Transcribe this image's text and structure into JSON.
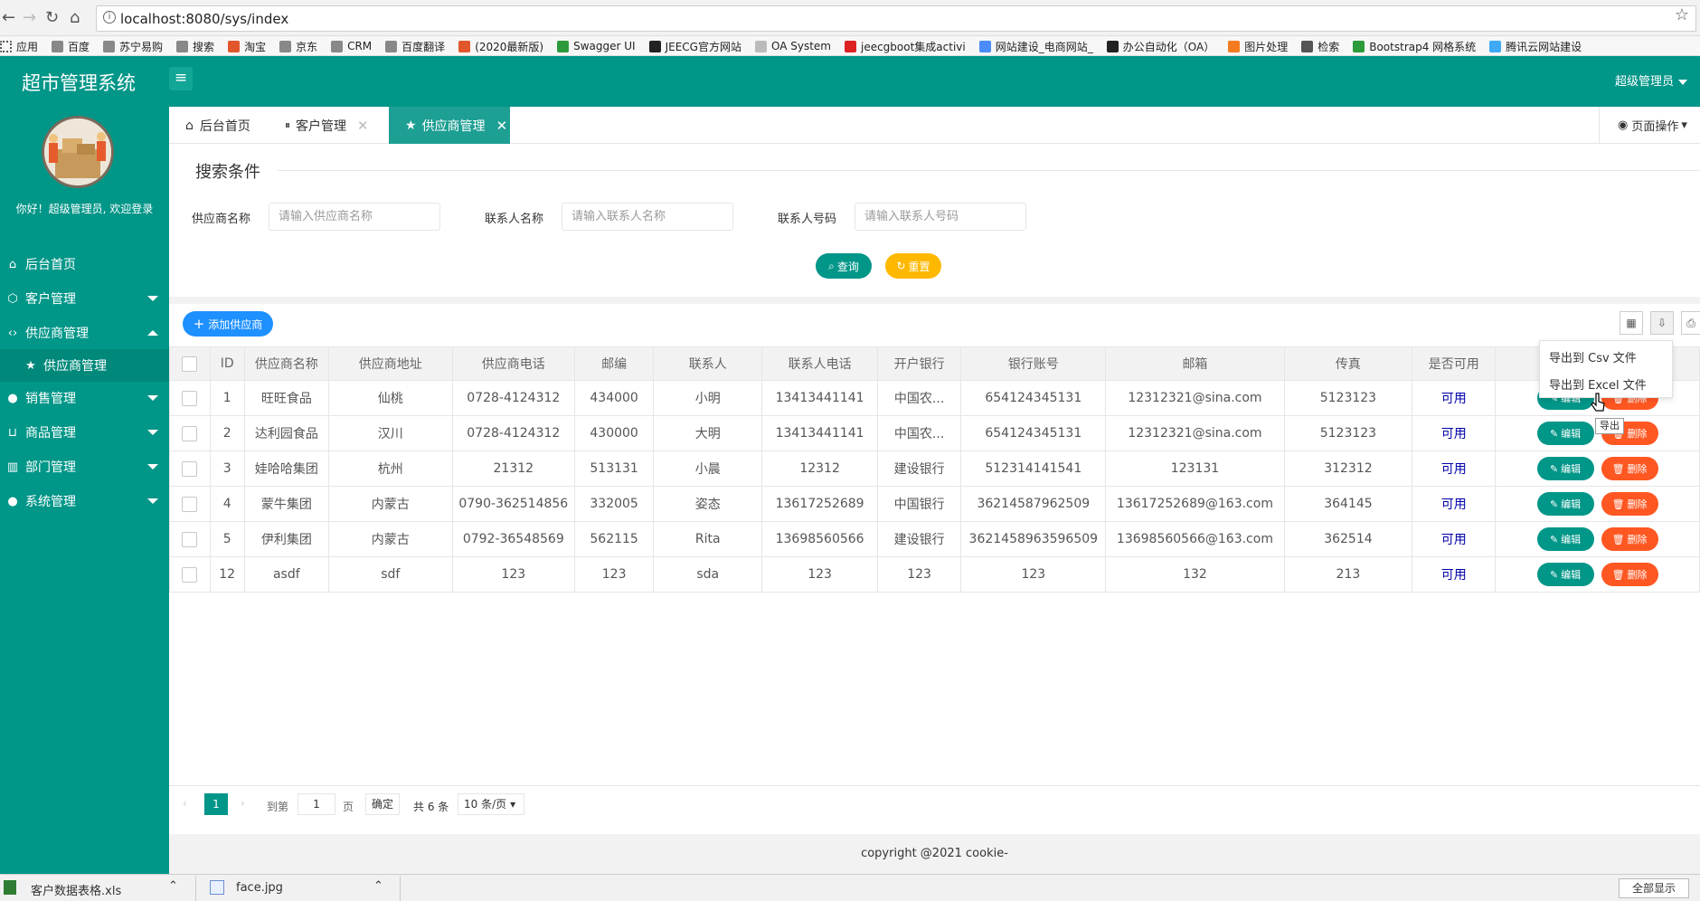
{
  "browser": {
    "url": "localhost:8080/sys/index",
    "bookmarks": [
      "应用",
      "百度",
      "苏宁易购",
      "搜索",
      "淘宝",
      "京东",
      "CRM",
      "百度翻译",
      "(2020最新版)",
      "Swagger UI",
      "JEECG官方网站",
      "OA System",
      "jeecgboot集成activi",
      "网站建设_电商网站_",
      "办公自动化（OA）",
      "图片处理",
      "检索",
      "Bootstrap4 网格系统",
      "腾讯云网站建设"
    ]
  },
  "app": {
    "title": "超市管理系统",
    "user": "超级管理员",
    "welcome": "你好！超级管理员, 欢迎登录"
  },
  "sidebar": {
    "items": [
      {
        "label": "后台首页",
        "icon": "home-icon"
      },
      {
        "label": "客户管理",
        "icon": "cube-icon"
      },
      {
        "label": "供应商管理",
        "icon": "code-icon"
      },
      {
        "label": "供应商管理",
        "icon": "star-icon"
      },
      {
        "label": "销售管理",
        "icon": "chat-icon"
      },
      {
        "label": "商品管理",
        "icon": "cart-icon"
      },
      {
        "label": "部门管理",
        "icon": "building-icon"
      },
      {
        "label": "系统管理",
        "icon": "user-icon"
      }
    ]
  },
  "tabs": {
    "items": [
      "后台首页",
      "客户管理",
      "供应商管理"
    ],
    "page_ops": "页面操作"
  },
  "search": {
    "legend": "搜索条件",
    "name_label": "供应商名称",
    "name_placeholder": "请输入供应商名称",
    "contact_label": "联系人名称",
    "contact_placeholder": "请输入联系人名称",
    "phone_label": "联系人号码",
    "phone_placeholder": "请输入联系人号码",
    "query": "查询",
    "reset": "重置"
  },
  "toolbar": {
    "add": "添加供应商",
    "export_menu": [
      "导出到 Csv 文件",
      "导出到 Excel 文件"
    ],
    "tooltip": "导出"
  },
  "table": {
    "headers": [
      "ID",
      "供应商名称",
      "供应商地址",
      "供应商电话",
      "邮编",
      "联系人",
      "联系人电话",
      "开户银行",
      "银行账号",
      "邮箱",
      "传真",
      "是否可用"
    ],
    "edit": "编辑",
    "delete": "删除",
    "rows": [
      [
        "1",
        "旺旺食品",
        "仙桃",
        "0728-4124312",
        "434000",
        "小明",
        "13413441141",
        "中国农...",
        "654124345131",
        "12312321@sina.com",
        "5123123",
        "可用"
      ],
      [
        "2",
        "达利园食品",
        "汉川",
        "0728-4124312",
        "430000",
        "大明",
        "13413441141",
        "中国农...",
        "654124345131",
        "12312321@sina.com",
        "5123123",
        "可用"
      ],
      [
        "3",
        "娃哈哈集团",
        "杭州",
        "21312",
        "513131",
        "小晨",
        "12312",
        "建设银行",
        "512314141541",
        "123131",
        "312312",
        "可用"
      ],
      [
        "4",
        "蒙牛集团",
        "内蒙古",
        "0790-362514856",
        "332005",
        "姿态",
        "13617252689",
        "中国银行",
        "36214587962509",
        "13617252689@163.com",
        "364145",
        "可用"
      ],
      [
        "5",
        "伊利集团",
        "内蒙古",
        "0792-36548569",
        "562115",
        "Rita",
        "13698560566",
        "建设银行",
        "3621458963596509",
        "13698560566@163.com",
        "362514",
        "可用"
      ],
      [
        "12",
        "asdf",
        "sdf",
        "123",
        "123",
        "sda",
        "123",
        "123",
        "123",
        "132",
        "213",
        "可用"
      ]
    ]
  },
  "pagination": {
    "current": "1",
    "goto_label": "到第",
    "goto_value": "1",
    "page_suffix": "页",
    "confirm": "确定",
    "total": "共 6 条",
    "per_page": "10 条/页"
  },
  "footer": "copyright @2021 cookie-",
  "downloads": {
    "items": [
      "客户数据表格.xls",
      "face.jpg"
    ],
    "show_all": "全部显示"
  }
}
